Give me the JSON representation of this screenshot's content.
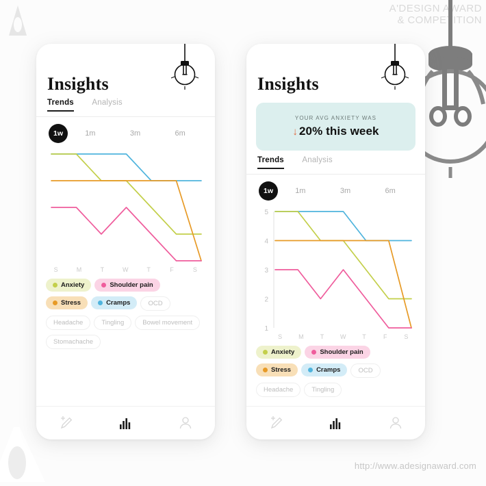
{
  "watermark": {
    "award_line1": "A'DESIGN AWARD",
    "award_line2": "& COMPETITION",
    "url": "http://www.adesignaward.com",
    "logo_icon": "a-design-award-logo-icon",
    "deco_icon": "large-lightbulb-decoration-icon"
  },
  "phone_left": {
    "title": "Insights",
    "bulb_icon": "lightbulb-icon",
    "tabs": [
      {
        "label": "Trends",
        "active": true
      },
      {
        "label": "Analysis",
        "active": false
      }
    ],
    "ranges": [
      {
        "label": "1w",
        "active": true
      },
      {
        "label": "1m",
        "active": false
      },
      {
        "label": "3m",
        "active": false
      },
      {
        "label": "6m",
        "active": false
      }
    ],
    "chips": [
      {
        "label": "Anxiety",
        "state": "on",
        "dot": "#c3cf4a",
        "bg": "#eef2cc"
      },
      {
        "label": "Shoulder pain",
        "state": "on",
        "dot": "#ef5c9c",
        "bg": "#fbd4e5"
      },
      {
        "label": "Stress",
        "state": "on",
        "dot": "#e79a26",
        "bg": "#f8dfb7"
      },
      {
        "label": "Cramps",
        "state": "on",
        "dot": "#4fb4dd",
        "bg": "#d3ecf7"
      },
      {
        "label": "OCD",
        "state": "off",
        "dot": "",
        "bg": "#ffffff"
      },
      {
        "label": "Headache",
        "state": "off",
        "dot": "",
        "bg": "#ffffff"
      },
      {
        "label": "Tingling",
        "state": "off",
        "dot": "",
        "bg": "#ffffff"
      },
      {
        "label": "Bowel movement",
        "state": "off",
        "dot": "",
        "bg": "#ffffff"
      },
      {
        "label": "Stomachache",
        "state": "off",
        "dot": "",
        "bg": "#ffffff"
      }
    ],
    "nav": [
      {
        "icon": "add-entry-pencil-icon",
        "active": false
      },
      {
        "icon": "bar-chart-icon",
        "active": true
      },
      {
        "icon": "profile-person-icon",
        "active": false
      }
    ]
  },
  "phone_right": {
    "title": "Insights",
    "bulb_icon": "lightbulb-icon",
    "banner": {
      "eyebrow": "YOUR AVG ANXIETY WAS",
      "arrow_icon": "arrow-down-icon",
      "headline": "20% this week",
      "bg": "#dcefee",
      "arrow_color": "#e2663a"
    },
    "tabs": [
      {
        "label": "Trends",
        "active": true
      },
      {
        "label": "Analysis",
        "active": false
      }
    ],
    "ranges": [
      {
        "label": "1w",
        "active": true
      },
      {
        "label": "1m",
        "active": false
      },
      {
        "label": "3m",
        "active": false
      },
      {
        "label": "6m",
        "active": false
      }
    ],
    "chips": [
      {
        "label": "Anxiety",
        "state": "on",
        "dot": "#c3cf4a",
        "bg": "#eef2cc"
      },
      {
        "label": "Shoulder pain",
        "state": "on",
        "dot": "#ef5c9c",
        "bg": "#fbd4e5"
      },
      {
        "label": "Stress",
        "state": "on",
        "dot": "#e79a26",
        "bg": "#f8dfb7"
      },
      {
        "label": "Cramps",
        "state": "on",
        "dot": "#4fb4dd",
        "bg": "#d3ecf7"
      },
      {
        "label": "OCD",
        "state": "off",
        "dot": "",
        "bg": "#ffffff"
      },
      {
        "label": "Headache",
        "state": "off",
        "dot": "",
        "bg": "#ffffff"
      },
      {
        "label": "Tingling",
        "state": "off",
        "dot": "",
        "bg": "#ffffff"
      }
    ],
    "nav": [
      {
        "icon": "add-entry-pencil-icon",
        "active": false
      },
      {
        "icon": "bar-chart-icon",
        "active": true
      },
      {
        "icon": "profile-person-icon",
        "active": false
      }
    ]
  },
  "chart_data": [
    {
      "id": "left-chart",
      "type": "line",
      "title": "",
      "xlabel": "",
      "ylabel": "",
      "categories": [
        "S",
        "M",
        "T",
        "W",
        "T",
        "F",
        "S"
      ],
      "ylim": [
        1,
        5
      ],
      "yticks": [
        1,
        2,
        3,
        4,
        5
      ],
      "show_yticks": false,
      "grid": false,
      "legend": "bottom",
      "series": [
        {
          "name": "Cramps",
          "color": "#4fb4dd",
          "values": [
            5,
            5,
            5,
            5,
            4,
            4,
            4
          ]
        },
        {
          "name": "Anxiety",
          "color": "#c3cf4a",
          "values": [
            5,
            5,
            4,
            4,
            3,
            2,
            2
          ]
        },
        {
          "name": "Stress",
          "color": "#e79a26",
          "values": [
            4,
            4,
            4,
            4,
            4,
            4,
            1
          ]
        },
        {
          "name": "Shoulder pain",
          "color": "#ef5c9c",
          "values": [
            3,
            3,
            2,
            3,
            2,
            1,
            1
          ]
        }
      ]
    },
    {
      "id": "right-chart",
      "type": "line",
      "title": "",
      "xlabel": "",
      "ylabel": "",
      "categories": [
        "S",
        "M",
        "T",
        "W",
        "T",
        "F",
        "S"
      ],
      "ylim": [
        1,
        5
      ],
      "yticks": [
        1,
        2,
        3,
        4,
        5
      ],
      "show_yticks": true,
      "grid": false,
      "legend": "bottom",
      "series": [
        {
          "name": "Cramps",
          "color": "#4fb4dd",
          "values": [
            5,
            5,
            5,
            5,
            4,
            4,
            4
          ]
        },
        {
          "name": "Anxiety",
          "color": "#c3cf4a",
          "values": [
            5,
            5,
            4,
            4,
            3,
            2,
            2
          ]
        },
        {
          "name": "Stress",
          "color": "#e79a26",
          "values": [
            4,
            4,
            4,
            4,
            4,
            4,
            1
          ]
        },
        {
          "name": "Shoulder pain",
          "color": "#ef5c9c",
          "values": [
            3,
            3,
            2,
            3,
            2,
            1,
            1
          ]
        }
      ]
    }
  ]
}
